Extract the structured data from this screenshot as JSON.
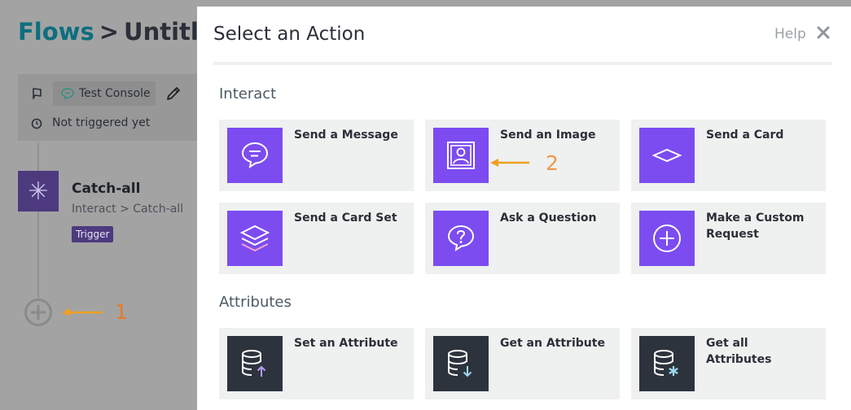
{
  "app": {
    "breadcrumb": {
      "root": "Flows",
      "separator": ">",
      "current": "Untitled"
    },
    "console": {
      "test_label": "Test Console",
      "status": "Not triggered yet"
    },
    "step": {
      "title": "Catch-all",
      "path": "Interact > Catch-all",
      "badge": "Trigger"
    },
    "annotation_1": "1",
    "icons": [
      "flag-icon",
      "chat-icon",
      "pencil-icon",
      "clock-icon",
      "asterisk-icon",
      "add-step-icon"
    ]
  },
  "modal": {
    "title": "Select an Action",
    "help": "Help",
    "close_glyph": "✕",
    "sections": {
      "interact": "Interact",
      "attributes": "Attributes"
    },
    "interact_tiles": [
      {
        "label": "Send a Message",
        "icon": "message-bubble-icon"
      },
      {
        "label": "Send an Image",
        "icon": "image-icon"
      },
      {
        "label": "Send a Card",
        "icon": "card-icon"
      },
      {
        "label": "Send a Card Set",
        "icon": "card-stack-icon"
      },
      {
        "label": "Ask a Question",
        "icon": "question-bubble-icon"
      },
      {
        "label": "Make a Custom Request",
        "icon": "plus-circle-icon"
      }
    ],
    "attribute_tiles": [
      {
        "label": "Set an Attribute",
        "icon": "database-upload-icon"
      },
      {
        "label": "Get an Attribute",
        "icon": "database-download-icon"
      },
      {
        "label": "Get all Attributes",
        "icon": "database-asterisk-icon"
      }
    ],
    "annotation_2": "2"
  },
  "colors": {
    "brand_teal": "#0e6e7e",
    "accent_purple": "#7c4cf0",
    "dark_tile": "#2d333d",
    "annotation_orange": "#f0a020",
    "tile_bg": "#eef1ef"
  }
}
